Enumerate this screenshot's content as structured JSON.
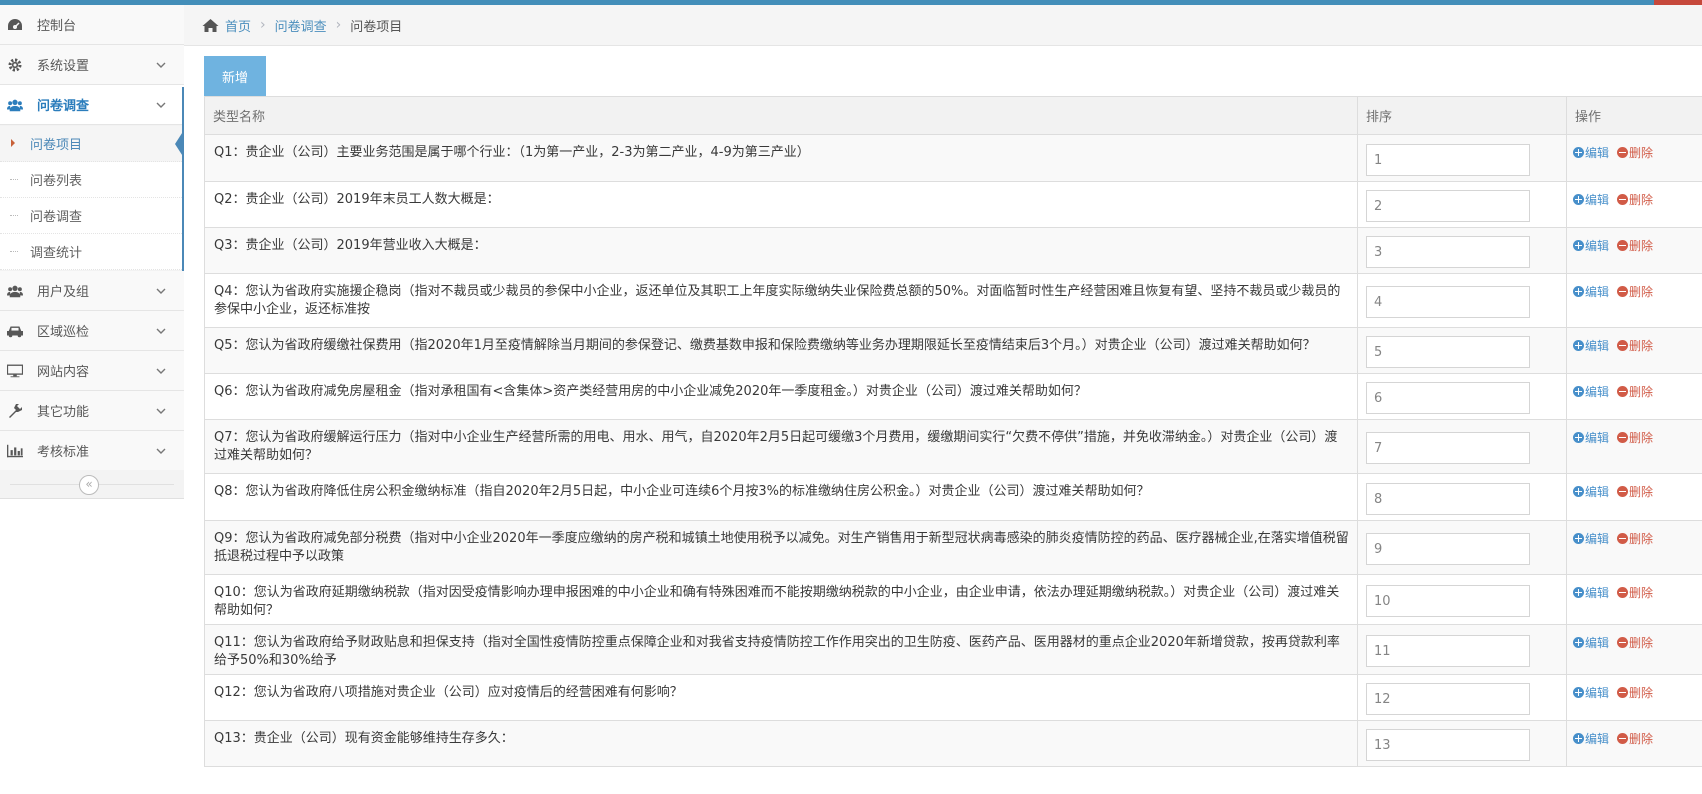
{
  "colors": {
    "accent": "#438eb9",
    "button": "#6fb3e0",
    "link": "#4c8fbd",
    "delete": "#d15b47"
  },
  "sidebar": {
    "items": [
      {
        "label": "控制台",
        "icon": "dashboard-icon",
        "has_chevron": false
      },
      {
        "label": "系统设置",
        "icon": "gear-icon",
        "has_chevron": true
      },
      {
        "label": "问卷调查",
        "icon": "users-icon",
        "has_chevron": true,
        "active": true,
        "children": [
          "问卷项目",
          "问卷列表",
          "问卷调查",
          "调查统计"
        ]
      },
      {
        "label": "用户及组",
        "icon": "users-icon",
        "has_chevron": true
      },
      {
        "label": "区域巡检",
        "icon": "car-icon",
        "has_chevron": true
      },
      {
        "label": "网站内容",
        "icon": "desktop-icon",
        "has_chevron": true
      },
      {
        "label": "其它功能",
        "icon": "wrench-icon",
        "has_chevron": true
      },
      {
        "label": "考核标准",
        "icon": "bar-chart-icon",
        "has_chevron": true
      }
    ],
    "collapse_glyph": "«"
  },
  "breadcrumb": {
    "home": "首页",
    "level2": "问卷调查",
    "current": "问卷项目",
    "separator": "›"
  },
  "toolbar": {
    "add_label": "新增"
  },
  "table": {
    "headers": {
      "name": "类型名称",
      "sort": "排序",
      "ops": "操作"
    },
    "edit_label": "编辑",
    "delete_label": "删除",
    "rows": [
      {
        "q": "Q1：贵企业（公司）主要业务范围是属于哪个行业：（1为第一产业，2-3为第二产业，4-9为第三产业）",
        "sort": "1"
      },
      {
        "q": "Q2：贵企业（公司）2019年末员工人数大概是：",
        "sort": "2"
      },
      {
        "q": "Q3：贵企业（公司）2019年营业收入大概是：",
        "sort": "3"
      },
      {
        "q": "Q4：您认为省政府实施援企稳岗（指对不裁员或少裁员的参保中小企业，返还单位及其职工上年度实际缴纳失业保险费总额的50%。对面临暂时性生产经营困难且恢复有望、坚持不裁员或少裁员的参保中小企业，返还标准按",
        "sort": "4"
      },
      {
        "q": "Q5：您认为省政府缓缴社保费用（指2020年1月至疫情解除当月期间的参保登记、缴费基数申报和保险费缴纳等业务办理期限延长至疫情结束后3个月。）对贵企业（公司）渡过难关帮助如何？",
        "sort": "5"
      },
      {
        "q": "Q6：您认为省政府减免房屋租金（指对承租国有<含集体>资产类经营用房的中小企业减免2020年一季度租金。）对贵企业（公司）渡过难关帮助如何？",
        "sort": "6"
      },
      {
        "q": "Q7：您认为省政府缓解运行压力（指对中小企业生产经营所需的用电、用水、用气，自2020年2月5日起可缓缴3个月费用，缓缴期间实行“欠费不停供”措施，并免收滞纳金。）对贵企业（公司）渡过难关帮助如何？",
        "sort": "7"
      },
      {
        "q": "Q8：您认为省政府降低住房公积金缴纳标准（指自2020年2月5日起，中小企业可连续6个月按3%的标准缴纳住房公积金。）对贵企业（公司）渡过难关帮助如何？",
        "sort": "8"
      },
      {
        "q": "Q9：您认为省政府减免部分税费（指对中小企业2020年一季度应缴纳的房产税和城镇土地使用税予以减免。对生产销售用于新型冠状病毒感染的肺炎疫情防控的药品、医疗器械企业,在落实增值税留抵退税过程中予以政策",
        "sort": "9"
      },
      {
        "q": "Q10：您认为省政府延期缴纳税款（指对因受疫情影响办理申报困难的中小企业和确有特殊困难而不能按期缴纳税款的中小企业，由企业申请，依法办理延期缴纳税款。）对贵企业（公司）渡过难关帮助如何？",
        "sort": "10"
      },
      {
        "q": "Q11：您认为省政府给予财政贴息和担保支持（指对全国性疫情防控重点保障企业和对我省支持疫情防控工作作用突出的卫生防疫、医药产品、医用器材的重点企业2020年新增贷款，按再贷款利率给予50%和30%给予",
        "sort": "11"
      },
      {
        "q": "Q12：您认为省政府八项措施对贵企业（公司）应对疫情后的经营困难有何影响？",
        "sort": "12"
      },
      {
        "q": "Q13：贵企业（公司）现有资金能够维持生存多久：",
        "sort": "13"
      }
    ]
  }
}
